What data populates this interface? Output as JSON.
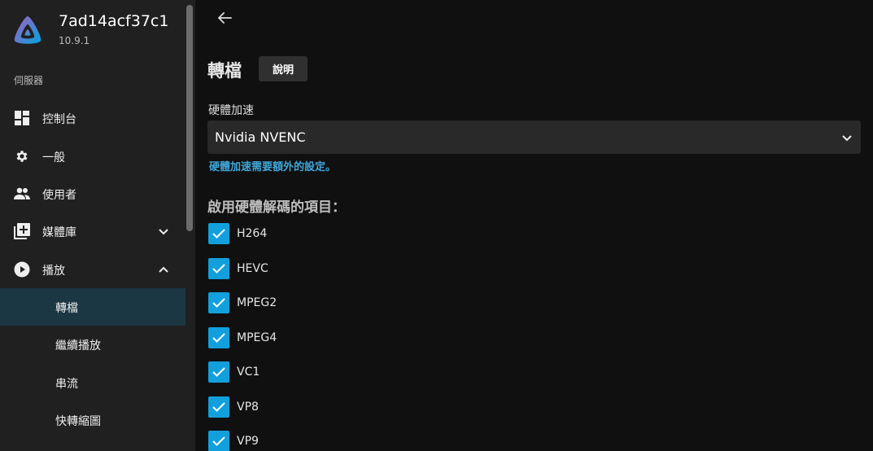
{
  "sidebar": {
    "server_name": "7ad14acf37c1",
    "version": "10.9.1",
    "section_label": "伺服器",
    "items": [
      {
        "label": "控制台",
        "icon": "dashboard-icon"
      },
      {
        "label": "一般",
        "icon": "gear-icon"
      },
      {
        "label": "使用者",
        "icon": "people-icon"
      },
      {
        "label": "媒體庫",
        "icon": "library-add-icon",
        "expanded": false
      },
      {
        "label": "播放",
        "icon": "play-circle-icon",
        "expanded": true
      }
    ],
    "sub_items": [
      {
        "label": "轉檔",
        "active": true
      },
      {
        "label": "繼續播放",
        "active": false
      },
      {
        "label": "串流",
        "active": false
      },
      {
        "label": "快轉縮圖",
        "active": false
      }
    ]
  },
  "main": {
    "title": "轉檔",
    "help_label": "說明",
    "hw_accel": {
      "label": "硬體加速",
      "value": "Nvidia NVENC",
      "help_link": "硬體加速需要額外的設定。"
    },
    "decoding": {
      "heading": "啟用硬體解碼的項目：",
      "codecs": [
        {
          "label": "H264",
          "checked": true
        },
        {
          "label": "HEVC",
          "checked": true
        },
        {
          "label": "MPEG2",
          "checked": true
        },
        {
          "label": "MPEG4",
          "checked": true
        },
        {
          "label": "VC1",
          "checked": true
        },
        {
          "label": "VP8",
          "checked": true
        },
        {
          "label": "VP9",
          "checked": true
        }
      ]
    }
  },
  "colors": {
    "accent": "#12a0dd",
    "link": "#3fa6d8",
    "active_bg": "#1b3743",
    "sidebar_bg": "#202020",
    "main_bg": "#101010"
  }
}
